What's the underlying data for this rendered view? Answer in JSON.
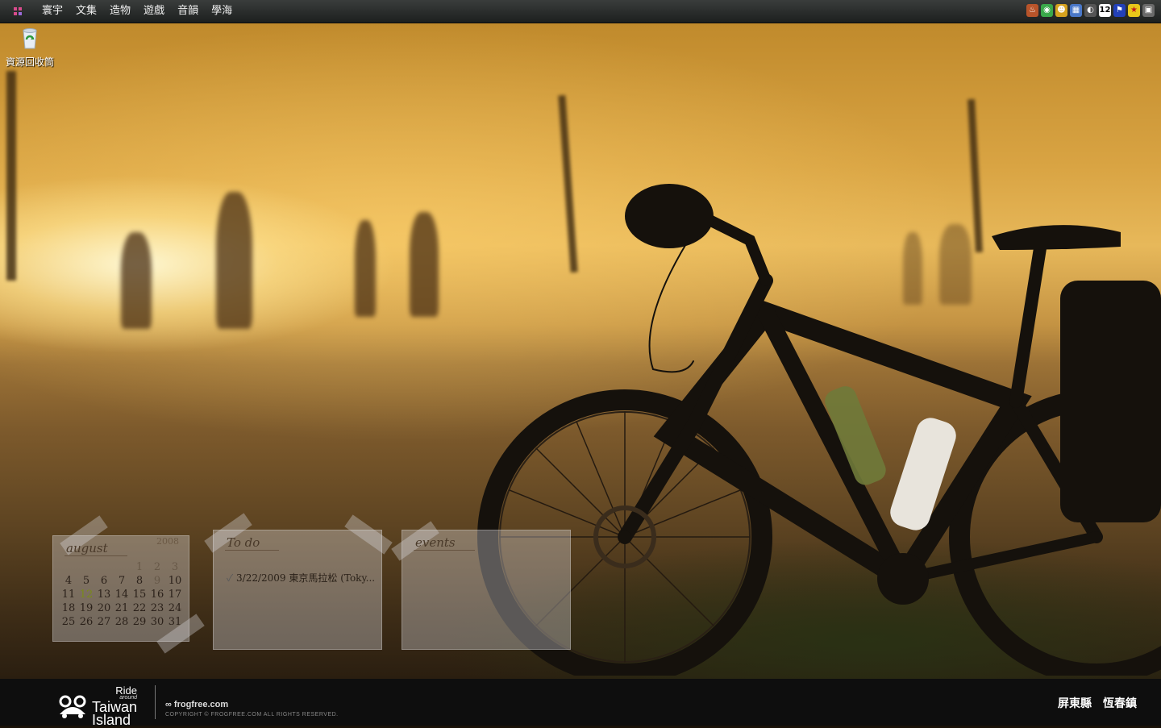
{
  "menubar": {
    "start_icon": "grid-icon",
    "items": [
      "寰宇",
      "文集",
      "造物",
      "遊戲",
      "音韻",
      "學海"
    ],
    "tray_icons": [
      "flame-icon",
      "chat-icon",
      "globe-icon",
      "network-icon",
      "speaker-icon",
      "date-icon",
      "flag-icon",
      "star-icon",
      "window-icon"
    ],
    "date_badge": "12"
  },
  "desktop": {
    "recycle_bin_label": "資源回收筒"
  },
  "calendar": {
    "title": "august",
    "year": "2008",
    "weeks": [
      [
        "",
        "",
        "",
        "",
        "1",
        "2",
        "3"
      ],
      [
        "4",
        "5",
        "6",
        "7",
        "8",
        "9",
        "10"
      ],
      [
        "11",
        "12",
        "13",
        "14",
        "15",
        "16",
        "17"
      ],
      [
        "18",
        "19",
        "20",
        "21",
        "22",
        "23",
        "24"
      ],
      [
        "25",
        "26",
        "27",
        "28",
        "29",
        "30",
        "31"
      ]
    ],
    "today": "12"
  },
  "todo": {
    "title": "To do",
    "items": [
      "3/22/2009 東京馬拉松 (Toky..."
    ]
  },
  "events": {
    "title": "events"
  },
  "footer": {
    "brand_ride": "Ride",
    "brand_around": "around",
    "brand_taiwan": "Taiwan",
    "brand_island": "Island",
    "site": "frogfree.com",
    "copyright": "COPYRIGHT © FROGFREE.COM ALL RIGHTS RESERVED.",
    "location": "屏東縣　恆春鎮"
  },
  "colors": {
    "menubar": "#2a2d2c",
    "sky_gold": "#e7b85a",
    "bottom_bar": "#0e0e0e"
  }
}
